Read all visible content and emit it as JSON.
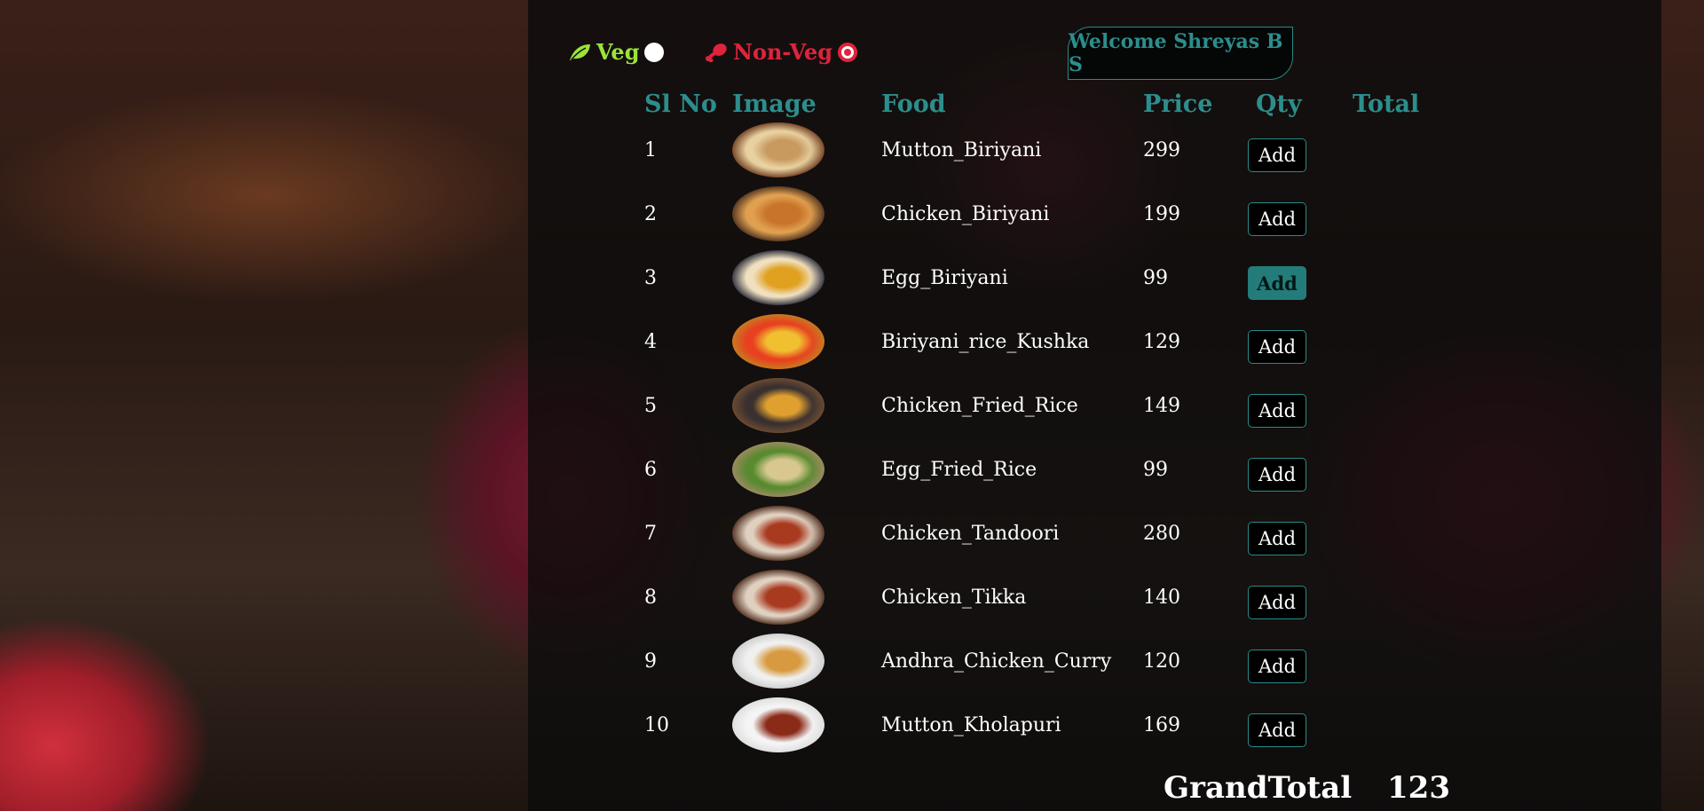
{
  "filters": {
    "veg_label": "Veg",
    "nonveg_label": "Non-Veg",
    "selected": "nonveg",
    "veg_color": "#9be33a",
    "nonveg_color": "#e0233c"
  },
  "welcome": "Welcome Shreyas B S",
  "table": {
    "headers": [
      "Sl No",
      "Image",
      "Food",
      "Price",
      "Qty",
      "Total"
    ],
    "rows": [
      {
        "sl": "1",
        "food": "Mutton_Biriyani",
        "price": "299",
        "qty": "Add",
        "thumb": [
          "#7a4a2a",
          "#c89a60",
          "#e8d0a0"
        ]
      },
      {
        "sl": "2",
        "food": "Chicken_Biriyani",
        "price": "199",
        "qty": "Add",
        "thumb": [
          "#5a3a22",
          "#c8742a",
          "#e0a050"
        ]
      },
      {
        "sl": "3",
        "food": "Egg_Biriyani",
        "price": "99",
        "qty": "Add",
        "thumb": [
          "#3a3a44",
          "#e0a020",
          "#f0e0c0"
        ]
      },
      {
        "sl": "4",
        "food": "Biriyani_rice_Kushka",
        "price": "129",
        "qty": "Add",
        "thumb": [
          "#c87a20",
          "#f0c030",
          "#e84020"
        ]
      },
      {
        "sl": "5",
        "food": "Chicken_Fried_Rice",
        "price": "149",
        "qty": "Add",
        "thumb": [
          "#6a4a32",
          "#e0a030",
          "#3a3030"
        ]
      },
      {
        "sl": "6",
        "food": "Egg_Fried_Rice",
        "price": "99",
        "qty": "Add",
        "thumb": [
          "#9a8a60",
          "#d8c890",
          "#5a8a30"
        ]
      },
      {
        "sl": "7",
        "food": "Chicken_Tandoori",
        "price": "280",
        "qty": "Add",
        "thumb": [
          "#5a3a2a",
          "#a83a20",
          "#e0d0c0"
        ]
      },
      {
        "sl": "8",
        "food": "Chicken_Tikka",
        "price": "140",
        "qty": "Add",
        "thumb": [
          "#5a3a2a",
          "#a83a20",
          "#e0d0c0"
        ]
      },
      {
        "sl": "9",
        "food": "Andhra_Chicken_Curry",
        "price": "120",
        "qty": "Add",
        "thumb": [
          "#d0d0d0",
          "#d89a40",
          "#f0f0f0"
        ]
      },
      {
        "sl": "10",
        "food": "Mutton_Kholapuri",
        "price": "169",
        "qty": "Add",
        "thumb": [
          "#e0e0e0",
          "#8a2a18",
          "#f4f4f4"
        ]
      }
    ],
    "active_row_index": 2,
    "accent_color": "#2c8e8c"
  },
  "grand_total": {
    "label": "GrandTotal",
    "value": "123"
  }
}
